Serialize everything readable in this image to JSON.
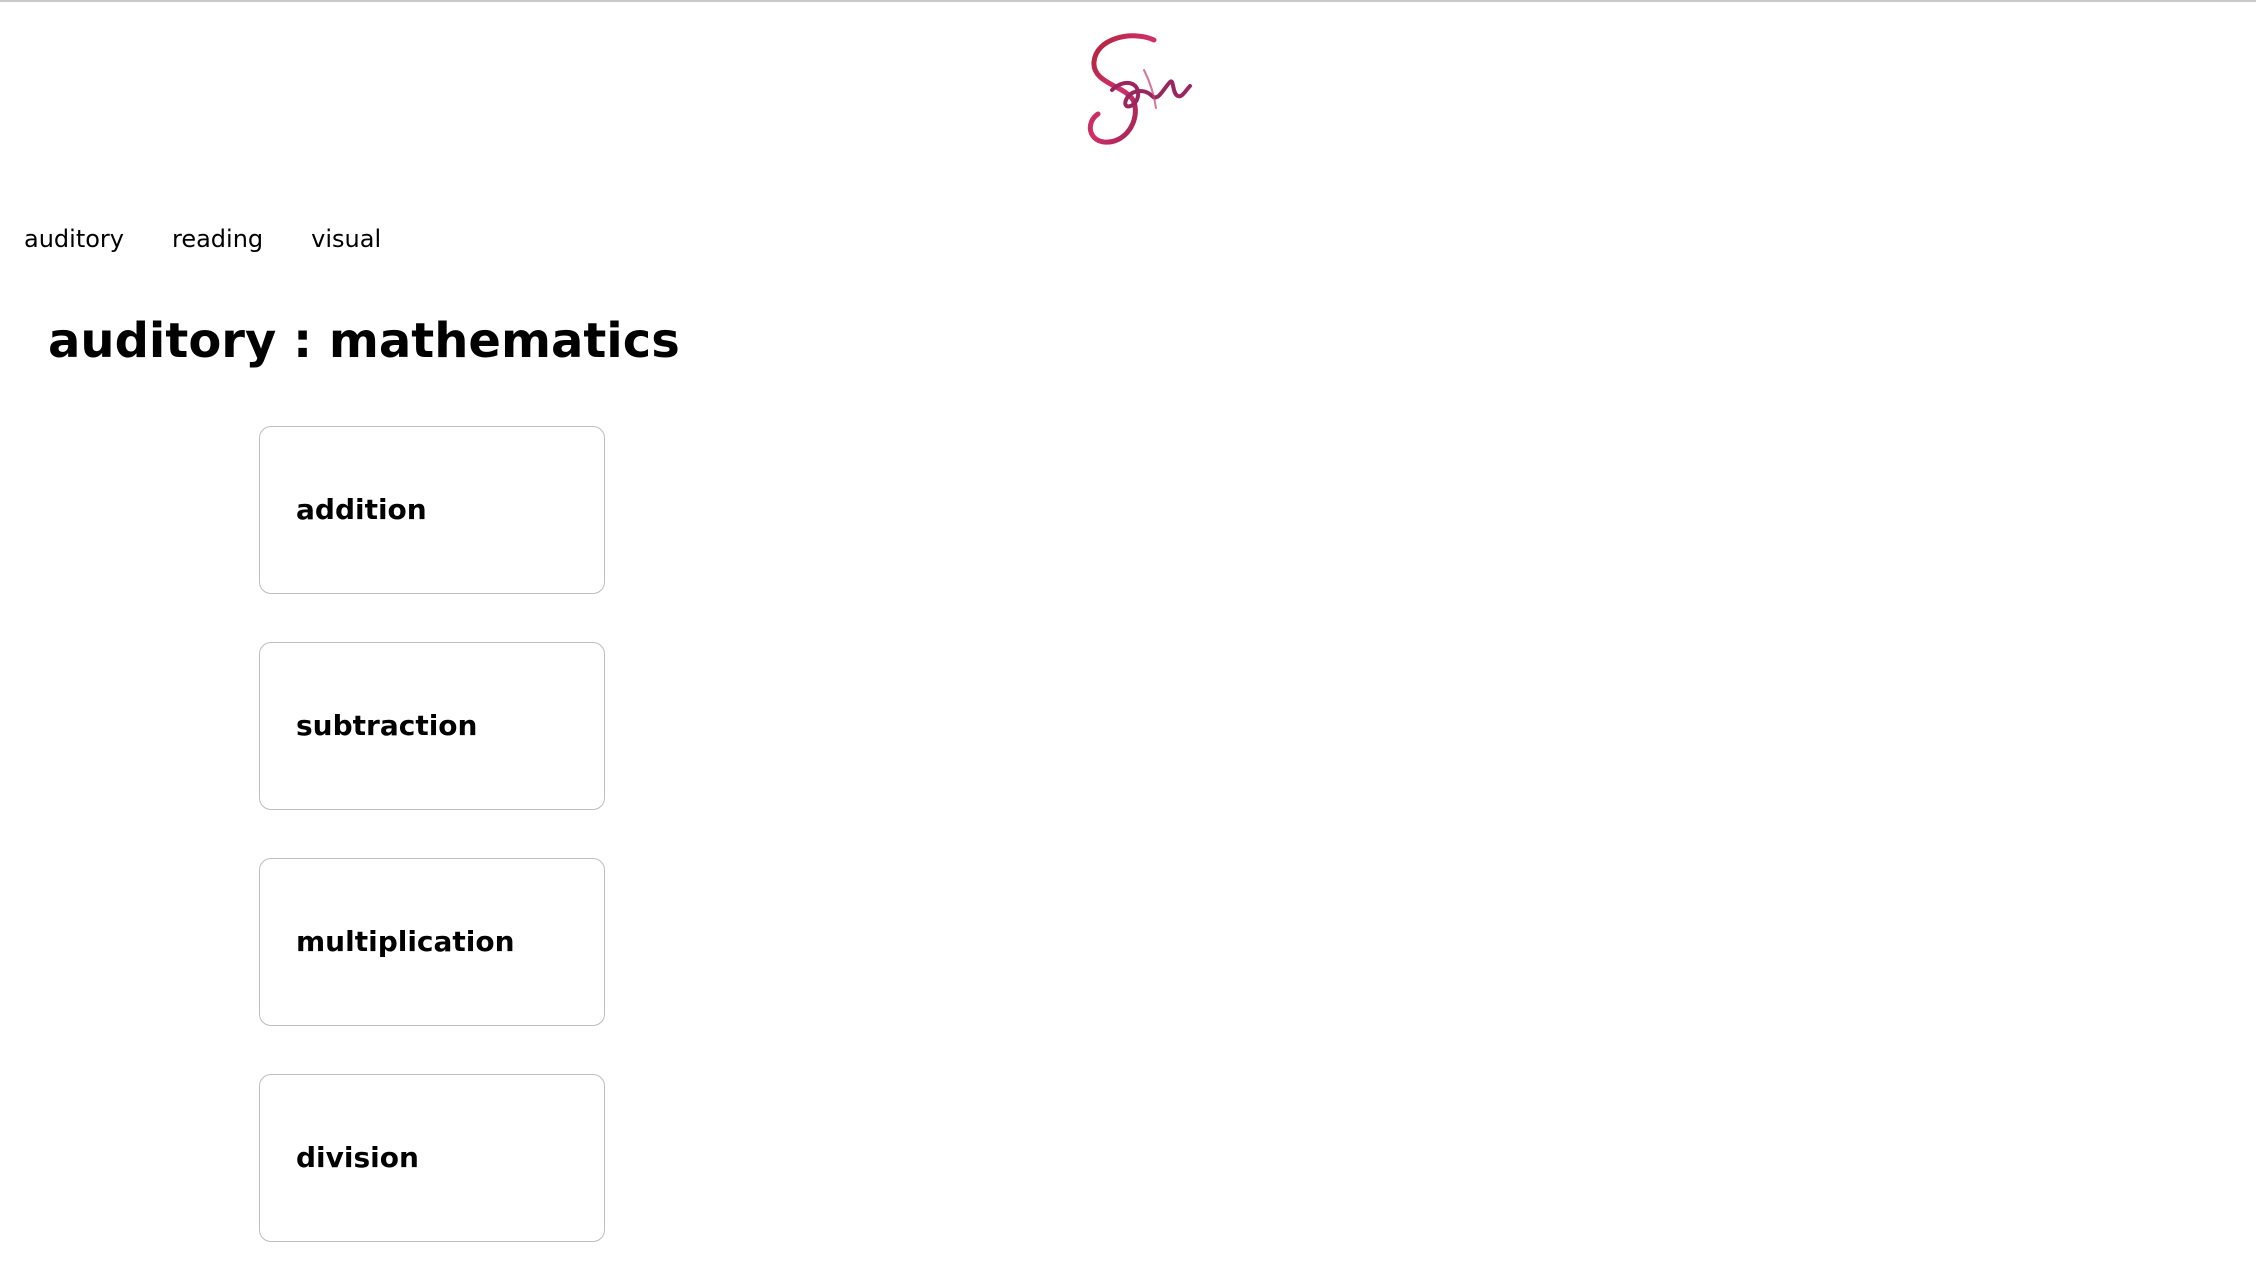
{
  "logo": {
    "icon": "script-s-logo",
    "colors": [
      "#b0243a",
      "#d0306a",
      "#8a1e4c"
    ]
  },
  "nav": {
    "items": [
      {
        "label": "auditory"
      },
      {
        "label": "reading"
      },
      {
        "label": "visual"
      }
    ]
  },
  "main": {
    "title": "auditory : mathematics",
    "topics": [
      {
        "label": "addition"
      },
      {
        "label": "subtraction"
      },
      {
        "label": "multiplication"
      },
      {
        "label": "division"
      }
    ]
  },
  "colors": {
    "background": "#ffffff",
    "card_border": "#bdbdbd",
    "text": "#000000"
  }
}
